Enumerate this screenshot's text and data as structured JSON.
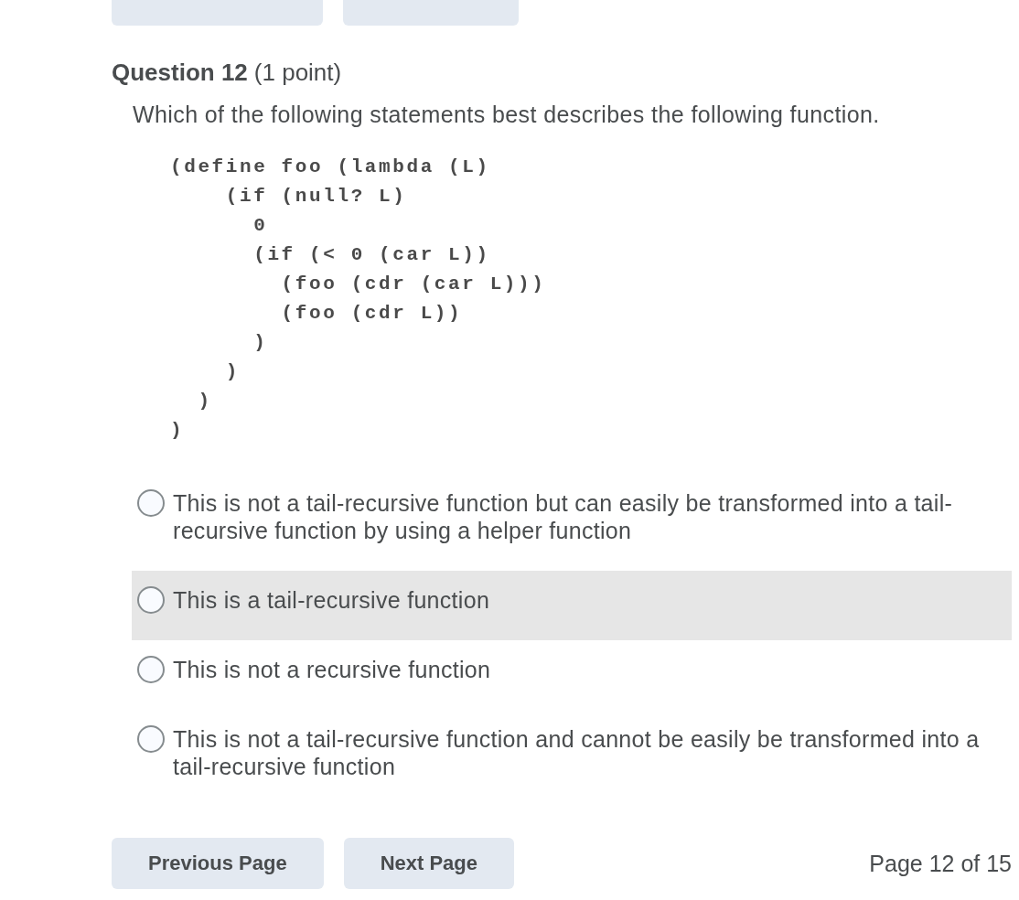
{
  "top_nav": {
    "buttons": [
      {
        "kind": "previous"
      },
      {
        "kind": "next"
      }
    ]
  },
  "question": {
    "title": "Question 12",
    "points": "(1 point)",
    "prompt": "Which of the following statements best describes the following function.",
    "code": "(define foo (lambda (L)\n    (if (null? L)\n      0\n      (if (< 0 (car L))\n        (foo (cdr (car L)))\n        (foo (cdr L))\n      )\n    )\n  )\n)",
    "options": [
      {
        "label": "This is not a tail-recursive function but can easily be transformed into a tail-recursive function by using a helper function",
        "selected": false,
        "hovered": false
      },
      {
        "label": "This is a tail-recursive function",
        "selected": false,
        "hovered": true
      },
      {
        "label": "This is not a recursive function",
        "selected": false,
        "hovered": false
      },
      {
        "label": "This is not a tail-recursive function and cannot be easily be transformed into a tail-recursive function",
        "selected": false,
        "hovered": false
      }
    ]
  },
  "bottom_nav": {
    "buttons": [
      "Previous Page",
      "Next Page"
    ],
    "page_indicator": "Page 12 of 15"
  }
}
